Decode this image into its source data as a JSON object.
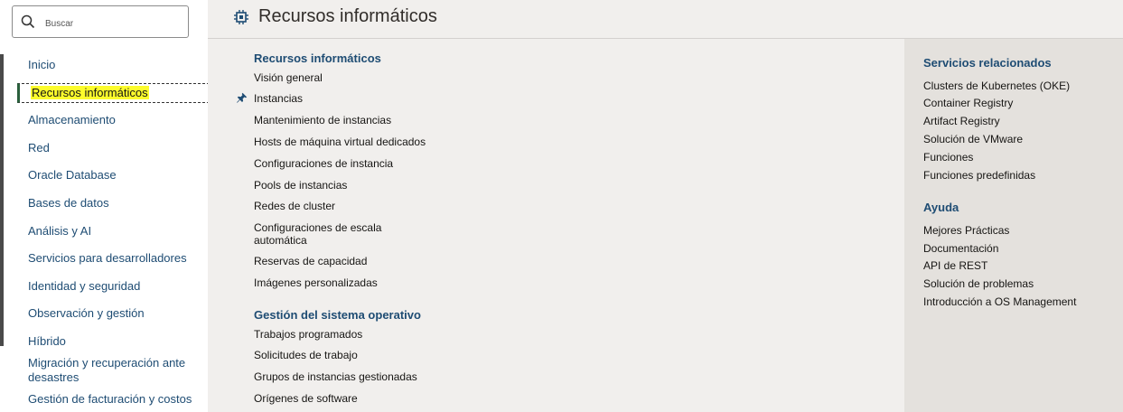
{
  "search": {
    "placeholder": "Buscar"
  },
  "leftnav": {
    "items": [
      {
        "label": "Inicio"
      },
      {
        "label": "Recursos informáticos"
      },
      {
        "label": "Almacenamiento"
      },
      {
        "label": "Red"
      },
      {
        "label": "Oracle Database"
      },
      {
        "label": "Bases de datos"
      },
      {
        "label": "Análisis y AI"
      },
      {
        "label": "Servicios para desarrolladores"
      },
      {
        "label": "Identidad y seguridad"
      },
      {
        "label": "Observación y gestión"
      },
      {
        "label": "Híbrido"
      },
      {
        "label": "Migración y recuperación ante desastres"
      },
      {
        "label": "Gestión de facturación y costos"
      }
    ]
  },
  "header": {
    "title": "Recursos informáticos",
    "icon": "cpu-chip-icon"
  },
  "main": {
    "sections": [
      {
        "title": "Recursos informáticos",
        "links": [
          "Visión general",
          "Instancias",
          "Mantenimiento de instancias",
          "Hosts de máquina virtual dedicados",
          "Configuraciones de instancia",
          "Pools de instancias",
          "Redes de cluster",
          "Configuraciones de escala automática",
          "Reservas de capacidad",
          "Imágenes personalizadas"
        ]
      },
      {
        "title": "Gestión del sistema operativo",
        "links": [
          "Trabajos programados",
          "Solicitudes de trabajo",
          "Grupos de instancias gestionadas",
          "Orígenes de software"
        ]
      }
    ]
  },
  "related": {
    "title": "Servicios relacionados",
    "links": [
      "Clusters de Kubernetes (OKE)",
      "Container Registry",
      "Artifact Registry",
      "Solución de VMware",
      "Funciones",
      "Funciones predefinidas"
    ]
  },
  "help": {
    "title": "Ayuda",
    "links": [
      "Mejores Prácticas",
      "Documentación",
      "API de REST",
      "Solución de problemas",
      "Introducción a OS Management"
    ]
  },
  "colors": {
    "link": "#1e4c73",
    "highlight": "#fcfc2c",
    "main_bg": "#f1efed",
    "panel_bg": "#e4e1dd"
  }
}
